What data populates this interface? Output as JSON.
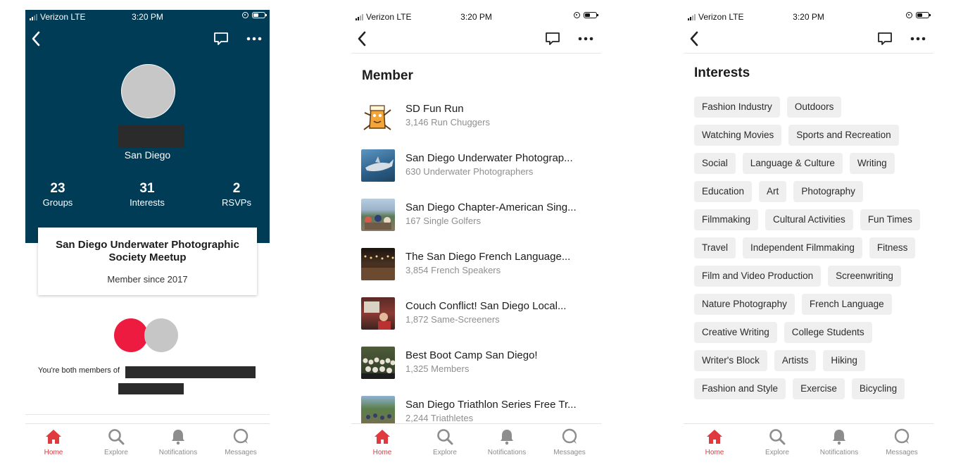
{
  "status": {
    "carrier": "Verizon LTE",
    "time": "3:20 PM"
  },
  "tabs": [
    "Home",
    "Explore",
    "Notifications",
    "Messages"
  ],
  "colors": {
    "hero": "#003c56",
    "accent": "#e0393e",
    "red_circle": "#ed1b40"
  },
  "profile": {
    "city": "San Diego",
    "stats": [
      {
        "num": "23",
        "label": "Groups"
      },
      {
        "num": "31",
        "label": "Interests"
      },
      {
        "num": "2",
        "label": "RSVPs"
      }
    ],
    "card_title": "San Diego Underwater Photographic Society Meetup",
    "card_since": "Member since 2017",
    "both_members": "You're both members of"
  },
  "groups": {
    "heading": "Member",
    "items": [
      {
        "name": "SD Fun Run",
        "meta": "3,146 Run Chuggers"
      },
      {
        "name": "San Diego Underwater Photograp...",
        "meta": "630 Underwater Photographers"
      },
      {
        "name": "San Diego Chapter-American Sing...",
        "meta": "167 Single Golfers"
      },
      {
        "name": "The San Diego French Language...",
        "meta": "3,854 French Speakers"
      },
      {
        "name": "Couch Conflict! San Diego Local...",
        "meta": "1,872 Same-Screeners"
      },
      {
        "name": "Best Boot Camp San Diego!",
        "meta": "1,325 Members"
      },
      {
        "name": "San Diego Triathlon Series Free Tr...",
        "meta": "2,244 Triathletes"
      }
    ]
  },
  "interests": {
    "heading": "Interests",
    "chips": [
      "Fashion Industry",
      "Outdoors",
      "Watching Movies",
      "Sports and Recreation",
      "Social",
      "Language & Culture",
      "Writing",
      "Education",
      "Art",
      "Photography",
      "Filmmaking",
      "Cultural Activities",
      "Fun Times",
      "Travel",
      "Independent Filmmaking",
      "Fitness",
      "Film and Video Production",
      "Screenwriting",
      "Nature Photography",
      "French Language",
      "Creative Writing",
      "College Students",
      "Writer's Block",
      "Artists",
      "Hiking",
      "Fashion and Style",
      "Exercise",
      "Bicycling"
    ]
  }
}
